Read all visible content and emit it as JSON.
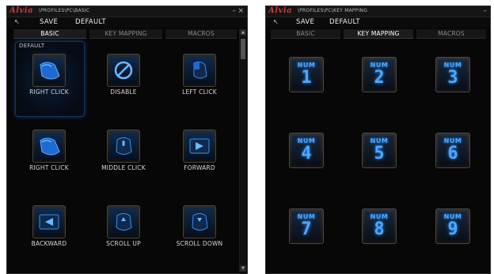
{
  "windows": [
    {
      "logo": "Alvia",
      "path": "\\PROFILES\\PC\\BASIC",
      "toolbar": {
        "back_icon": "back-arrow-icon",
        "save": "SAVE",
        "default": "DEFAULT"
      },
      "tabs": [
        {
          "label": "BASIC",
          "active": true
        },
        {
          "label": "KEY MAPPING",
          "active": false
        },
        {
          "label": "MACROS",
          "active": false
        }
      ],
      "section_label": "DEFAULT",
      "buttons": [
        {
          "label": "RIGHT CLICK",
          "icon": "mouse-right-click-icon"
        },
        {
          "label": "DISABLE",
          "icon": "disable-icon"
        },
        {
          "label": "LEFT CLICK",
          "icon": "mouse-left-click-icon"
        },
        {
          "label": "RIGHT CLICK",
          "icon": "mouse-right-click-icon"
        },
        {
          "label": "MIDDLE CLICK",
          "icon": "mouse-middle-click-icon"
        },
        {
          "label": "FORWARD",
          "icon": "forward-icon"
        },
        {
          "label": "BACKWARD",
          "icon": "backward-icon"
        },
        {
          "label": "SCROLL UP",
          "icon": "scroll-up-icon"
        },
        {
          "label": "SCROLL DOWN",
          "icon": "scroll-down-icon"
        }
      ],
      "controls": {
        "minimize": "–",
        "close": "×"
      }
    },
    {
      "logo": "Alvia",
      "path": "\\PROFILES\\PC\\KEY MAPPING",
      "toolbar": {
        "back_icon": "back-arrow-icon",
        "save": "SAVE",
        "default": "DEFAULT"
      },
      "tabs": [
        {
          "label": "BASIC",
          "active": false
        },
        {
          "label": "KEY MAPPING",
          "active": true
        },
        {
          "label": "MACROS",
          "active": false
        }
      ],
      "keys": [
        {
          "prefix": "NUM",
          "digit": "1"
        },
        {
          "prefix": "NUM",
          "digit": "2"
        },
        {
          "prefix": "NUM",
          "digit": "3"
        },
        {
          "prefix": "NUM",
          "digit": "4"
        },
        {
          "prefix": "NUM",
          "digit": "5"
        },
        {
          "prefix": "NUM",
          "digit": "6"
        },
        {
          "prefix": "NUM",
          "digit": "7"
        },
        {
          "prefix": "NUM",
          "digit": "8"
        },
        {
          "prefix": "NUM",
          "digit": "9"
        }
      ],
      "controls": {
        "minimize": "–"
      }
    }
  ],
  "colors": {
    "logo": "#c83a3a",
    "accent_blue": "#3a9bff",
    "background": "#070707"
  }
}
